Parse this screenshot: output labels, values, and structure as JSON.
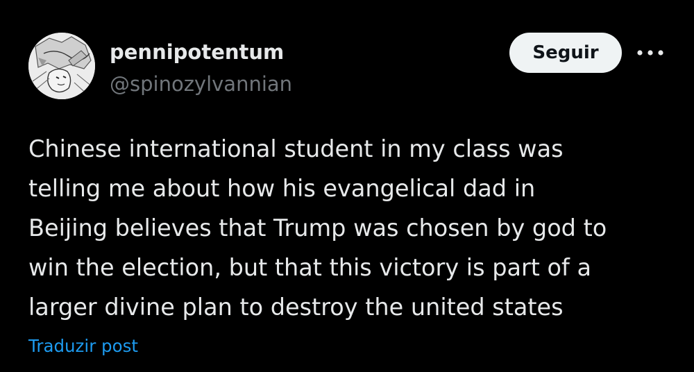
{
  "author": {
    "display_name": "pennipotentum",
    "handle": "@spinozylvannian",
    "avatar_icon": "anime-character-avatar"
  },
  "actions": {
    "follow_label": "Seguir",
    "more_icon": "more-horizontal-icon"
  },
  "tweet": {
    "text": "Chinese international student in my class was\ntelling me about how his evangelical dad in\nBeijing believes that Trump was chosen by god to\nwin the election, but that this victory is part of a\nlarger divine plan to destroy the united states"
  },
  "footer": {
    "translate_label": "Traduzir post"
  },
  "colors": {
    "background": "#000000",
    "text_primary": "#e7e9ea",
    "text_secondary": "#71767b",
    "link": "#1d9bf0",
    "button_bg": "#eff3f4",
    "button_text": "#0f1419"
  }
}
